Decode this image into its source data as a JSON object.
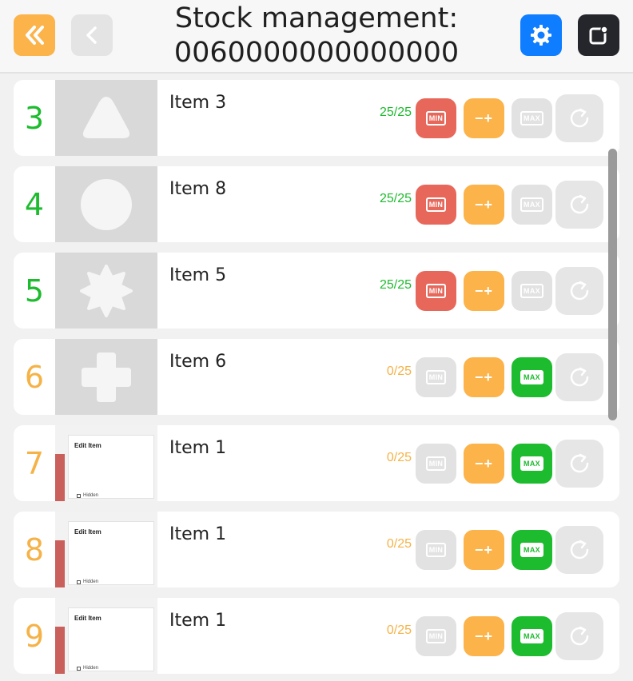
{
  "header": {
    "title": "Stock management: 0060000000000000",
    "icons": {
      "back_all": "double-chevron-left-icon",
      "back": "chevron-left-icon",
      "settings": "gear-icon",
      "window": "open-window-icon"
    }
  },
  "colors": {
    "min_active": "#e7685b",
    "max_active": "#1dbb2e",
    "plusminus": "#fbb34a",
    "disabled": "#e2e2e2",
    "full_stock_text": "#1dbb2e",
    "empty_stock_text": "#f5b246"
  },
  "button_labels": {
    "min": "MIN",
    "plusminus": "−+",
    "max": "MAX"
  },
  "items": [
    {
      "index": "3",
      "name": "Item 3",
      "stock": "25/25",
      "shape": "triangle",
      "state": "full"
    },
    {
      "index": "4",
      "name": "Item 8",
      "stock": "25/25",
      "shape": "circle",
      "state": "full"
    },
    {
      "index": "5",
      "name": "Item 5",
      "stock": "25/25",
      "shape": "star",
      "state": "full"
    },
    {
      "index": "6",
      "name": "Item 6",
      "stock": "0/25",
      "shape": "cross",
      "state": "empty"
    },
    {
      "index": "7",
      "name": "Item 1",
      "stock": "0/25",
      "shape": "screenshot",
      "state": "empty",
      "thumb_title": "Edit Item",
      "thumb_checkbox": "Hidden"
    },
    {
      "index": "8",
      "name": "Item 1",
      "stock": "0/25",
      "shape": "screenshot",
      "state": "empty",
      "thumb_title": "Edit Item",
      "thumb_checkbox": "Hidden"
    },
    {
      "index": "9",
      "name": "Item 1",
      "stock": "0/25",
      "shape": "screenshot",
      "state": "empty",
      "thumb_title": "Edit Item",
      "thumb_checkbox": "Hidden"
    }
  ]
}
